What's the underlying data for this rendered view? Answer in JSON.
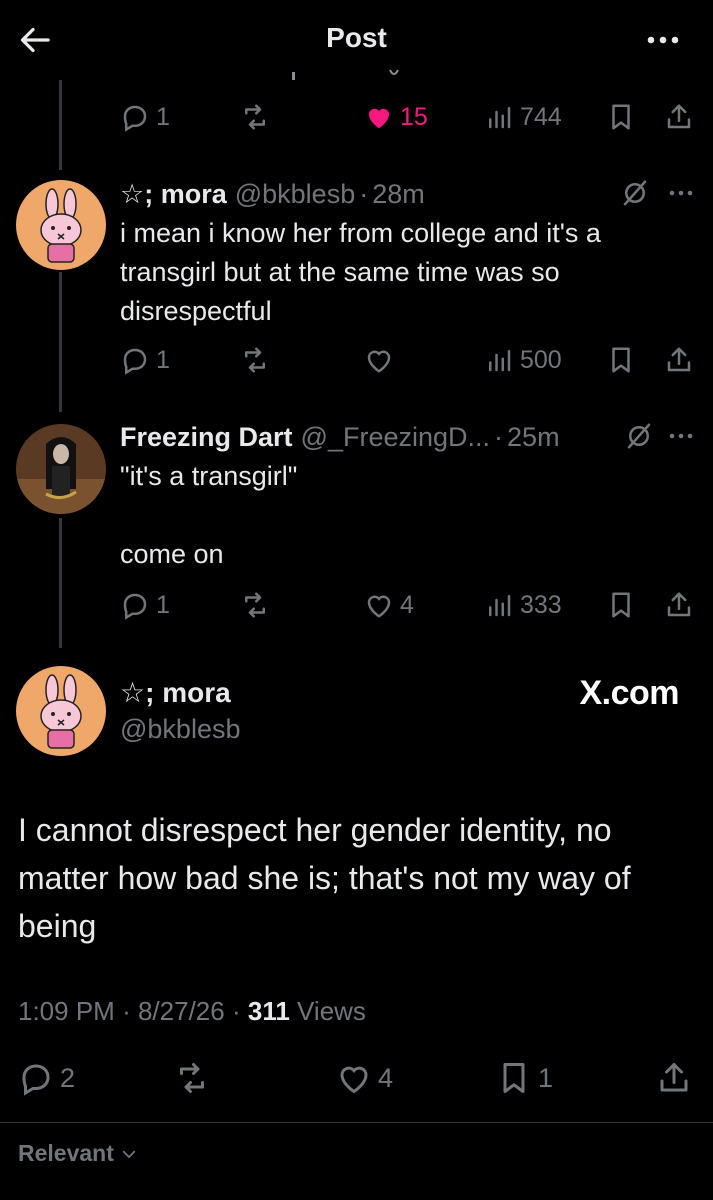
{
  "header": {
    "title": "Post"
  },
  "reply1": {
    "actions": {
      "replies": "1",
      "likes": "15",
      "views": "744"
    }
  },
  "reply2": {
    "name": "☆; mora",
    "handle": "@bkblesb",
    "separator": "·",
    "time": "28m",
    "text": "i mean i know her from college and it's a transgirl but at the same time was so disrespectful",
    "actions": {
      "replies": "1",
      "likes": "",
      "views": "500"
    }
  },
  "reply3": {
    "name": "Freezing Dart",
    "handle": "@_FreezingD...",
    "separator": "·",
    "time": "25m",
    "text": "\"it's a transgirl\"\n\ncome on",
    "actions": {
      "replies": "1",
      "likes": "4",
      "views": "333"
    }
  },
  "main_post": {
    "name": "☆; mora",
    "handle": "@bkblesb",
    "watermark": "X.com",
    "text": "I cannot disrespect her gender identity, no matter how bad she is; that's not my way of being",
    "time": "1:09 PM",
    "date": "8/27/26",
    "views_count": "311",
    "views_label": "Views",
    "separator": "·",
    "actions": {
      "replies": "2",
      "likes": "4",
      "bookmarks": "1"
    }
  },
  "sort": {
    "label": "Relevant"
  },
  "colors": {
    "background": "#000000",
    "text": "#e7e9ea",
    "muted": "#71767b",
    "like": "#f91880"
  }
}
